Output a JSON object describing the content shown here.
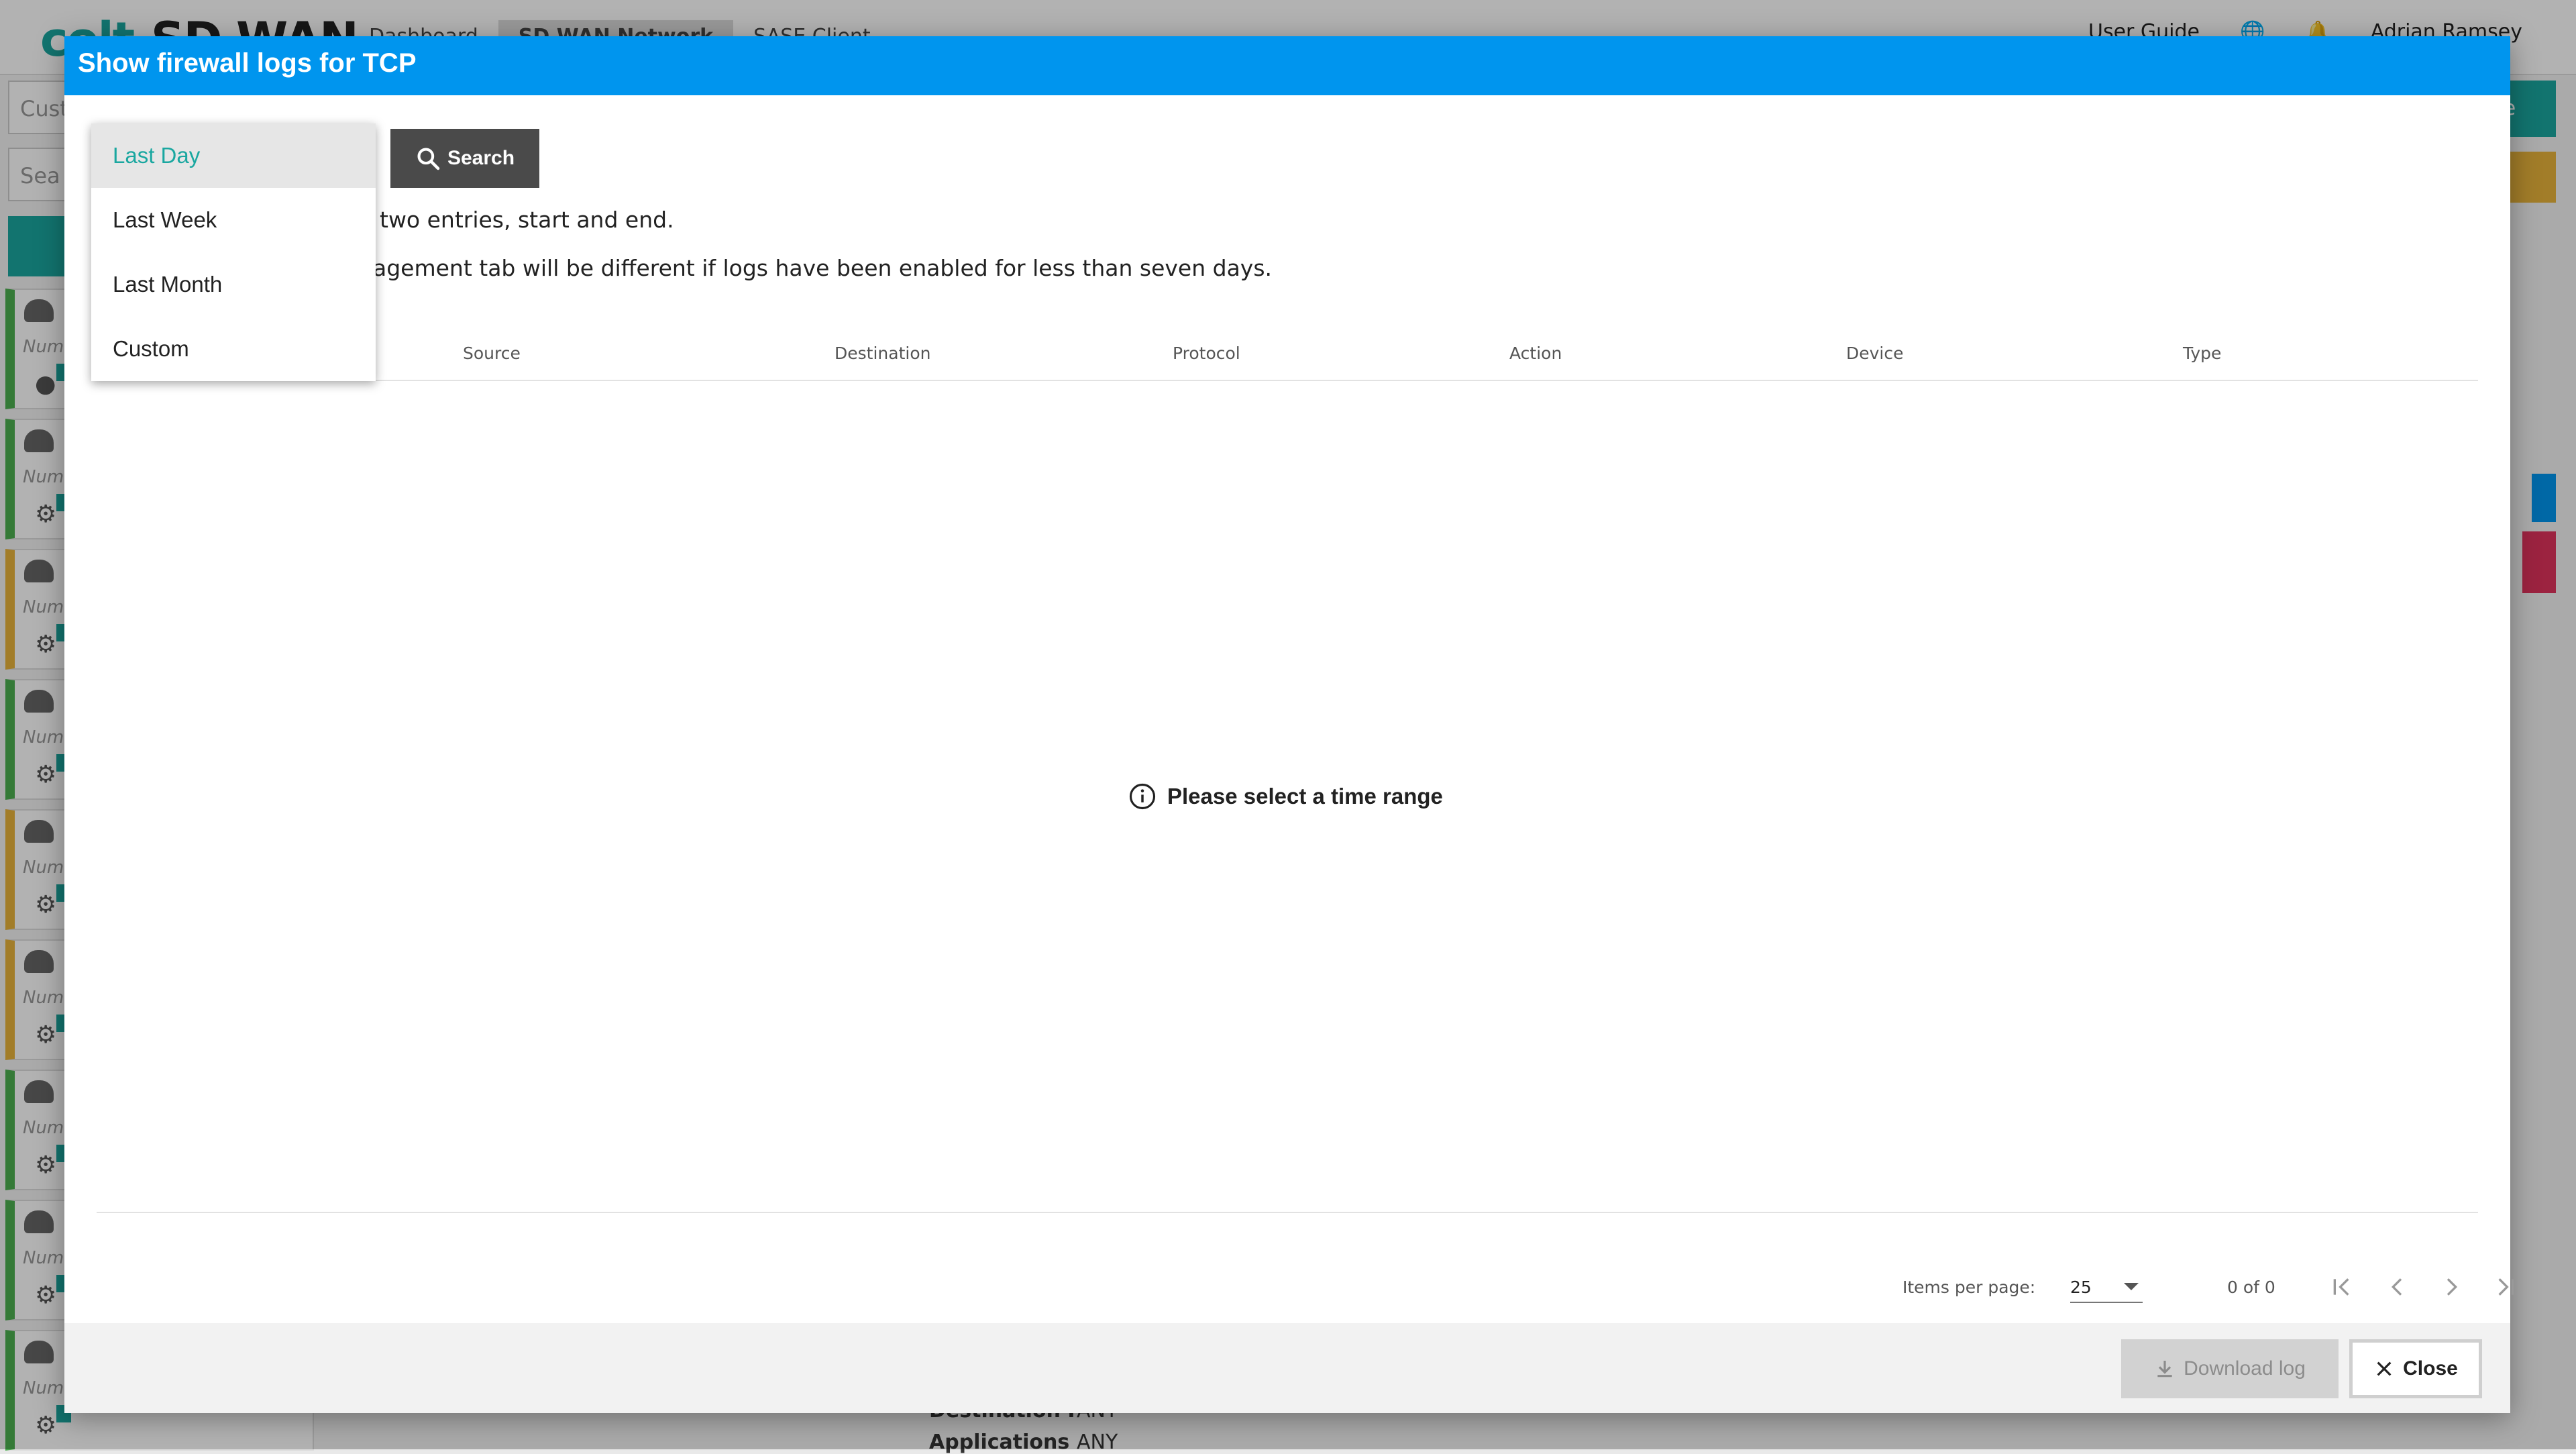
{
  "background": {
    "brand": "colt",
    "product": "SD WAN",
    "nav": [
      "Dashboard",
      "SD WAN Network",
      "SASE Client"
    ],
    "nav_active_index": 1,
    "user_guide": "User Guide",
    "user_name": "Adrian Ramsey",
    "customer_field": "Cust",
    "search_field": "Sea",
    "card_number_label": "Numi",
    "destination_label": "Destination I",
    "destination_value": "ANY",
    "applications_label": "Applications",
    "applications_value": "ANY",
    "right_button_text": "te"
  },
  "modal": {
    "title": "Show firewall logs for TCP",
    "search_button": "Search",
    "info_line_1": "two entries, start and end.",
    "info_line_2": "agement tab will be different if logs have been enabled for less than seven days.",
    "columns": [
      "Source",
      "Destination",
      "Protocol",
      "Action",
      "Device",
      "Type"
    ],
    "empty_message": "Please select a time range",
    "paginator": {
      "items_per_page_label": "Items per page:",
      "items_per_page_value": "25",
      "range_label": "0 of 0"
    },
    "download_button": "Download log",
    "close_button": "Close"
  },
  "time_range_dropdown": {
    "options": [
      "Last Day",
      "Last Week",
      "Last Month",
      "Custom"
    ],
    "selected": "Last Day"
  },
  "colors": {
    "modal_header": "#0095ee",
    "accent_teal": "#1aa7a0",
    "search_button": "#4a4a4a",
    "status_green": "#4caf50",
    "status_amber": "#e8b43c"
  }
}
